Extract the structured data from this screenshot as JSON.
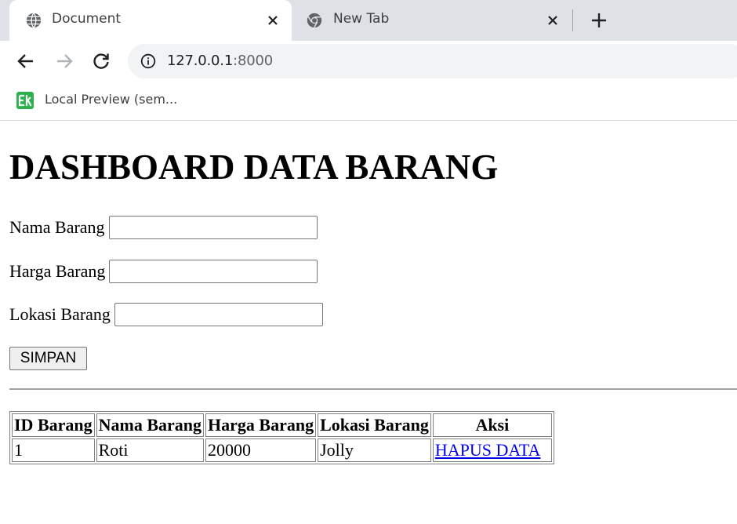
{
  "browser": {
    "tabs": [
      {
        "title": "Document",
        "favicon": "globe-icon",
        "active": true
      },
      {
        "title": "New Tab",
        "favicon": "chrome-icon",
        "active": false
      }
    ],
    "address": {
      "host": "127.0.0.1",
      "port": ":8000"
    },
    "bookmarks": [
      {
        "label": "Local Preview (sem...",
        "icon": "ek-icon",
        "icon_color": "#2bb24c"
      }
    ]
  },
  "page": {
    "heading": "DASHBOARD DATA BARANG",
    "form": {
      "nama_label": "Nama Barang",
      "nama_value": "",
      "harga_label": "Harga Barang",
      "harga_value": "",
      "lokasi_label": "Lokasi Barang",
      "lokasi_value": "",
      "submit_label": "SIMPAN"
    },
    "table": {
      "headers": [
        "ID Barang",
        "Nama Barang",
        "Harga Barang",
        "Lokasi Barang",
        "Aksi"
      ],
      "rows": [
        {
          "id": "1",
          "nama": "Roti",
          "harga": "20000",
          "lokasi": "Jolly",
          "aksi": "HAPUS DATA"
        }
      ]
    }
  },
  "colors": {
    "link": "#0000ee",
    "tabstrip": "#dee1e6",
    "omnibox": "#f1f3f4"
  }
}
